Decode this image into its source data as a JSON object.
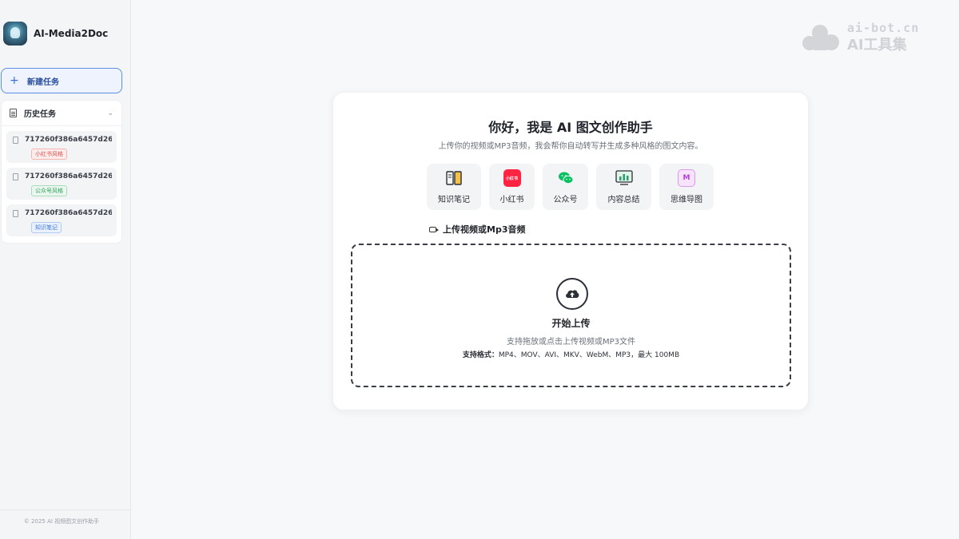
{
  "app": {
    "name": "AI-Media2Doc",
    "copyright": "© 2025 AI 视频图文创作助手"
  },
  "sidebar": {
    "new_task_label": "新建任务",
    "history_label": "历史任务",
    "history_items": [
      {
        "name": "717260f386a6457d26...",
        "tag": "小红书风格",
        "tag_color": "#d9534f"
      },
      {
        "name": "717260f386a6457d26...",
        "tag": "公众号风格",
        "tag_color": "#2f9e5b"
      },
      {
        "name": "717260f386a6457d26...",
        "tag": "知识笔记",
        "tag_color": "#3b78d8"
      }
    ]
  },
  "watermark": {
    "line1": "ai-bot.cn",
    "line2": "AI工具集"
  },
  "main": {
    "title": "你好，我是 AI 图文创作助手",
    "subtitle": "上传你的视频或MP3音频，我会帮你自动转写并生成多种风格的图文内容。",
    "modes": [
      {
        "label": "知识笔记",
        "icon": "book-icon",
        "icon_text": ""
      },
      {
        "label": "小红书",
        "icon": "xiaohongshu-icon",
        "icon_text": "小红书"
      },
      {
        "label": "公众号",
        "icon": "wechat-icon",
        "icon_text": ""
      },
      {
        "label": "内容总结",
        "icon": "chart-icon",
        "icon_text": ""
      },
      {
        "label": "思维导图",
        "icon": "mindmap-icon",
        "icon_text": "M"
      }
    ],
    "upload_label": "上传视频或Mp3音频",
    "dropzone": {
      "title": "开始上传",
      "subtitle": "支持拖放或点击上传视频或MP3文件",
      "formats_prefix": "支持格式：",
      "formats": "MP4、MOV、AVI、MKV、WebM、MP3，最大 100MB"
    }
  },
  "colors": {
    "accent": "#3b6fd6",
    "xiaohongshu": "#ff2442",
    "wechat": "#07c160"
  }
}
